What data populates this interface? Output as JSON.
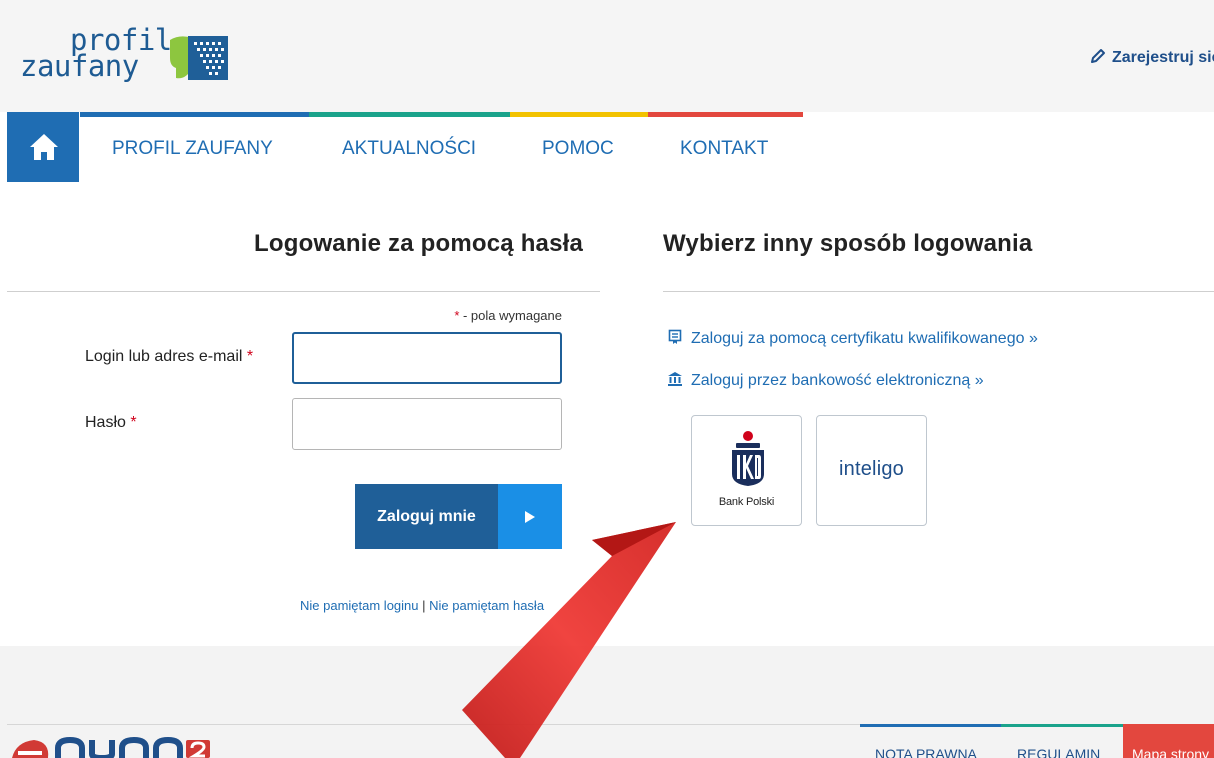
{
  "header": {
    "logo_line1": "profil",
    "logo_line2": "zaufany",
    "register_label": "Zarejestruj się"
  },
  "nav": {
    "items": [
      {
        "label": "Profil Zaufany"
      },
      {
        "label": "Aktualności"
      },
      {
        "label": "Pomoc"
      },
      {
        "label": "Kontakt"
      }
    ],
    "stripe_colors": [
      "#1f6db3",
      "#1aa38b",
      "#f2c200",
      "#e3473e"
    ]
  },
  "login": {
    "title": "Logowanie za pomocą hasła",
    "required_star": "*",
    "required_note": " - pola wymagane",
    "login_label": "Login lub adres e-mail",
    "password_label": "Hasło",
    "login_value": "",
    "password_value": "",
    "submit_label": "Zaloguj mnie",
    "forgot_login": "Nie pamiętam loginu",
    "separator": "|",
    "forgot_password": "Nie pamiętam hasła"
  },
  "alternative": {
    "title": "Wybierz inny sposób logowania",
    "certificate_link": "Zaloguj za pomocą certyfikatu kwalifikowanego »",
    "certificate_icon": "certificate-icon",
    "bank_link": "Zaloguj przez bankowość elektroniczną »",
    "bank_icon": "bank-icon",
    "banks": [
      {
        "name": "Bank Polski",
        "icon": "pko-logo-icon"
      },
      {
        "name": "inteligo"
      }
    ]
  },
  "footer": {
    "legal": "Nota prawna",
    "terms": "Regulamin",
    "sitemap": "Mapa strony"
  },
  "colors": {
    "primary": "#1f6db3",
    "dark_blue": "#1f5f98",
    "button_light": "#1a8fe6",
    "required": "#d0021b",
    "arrow_red": "#e52a28"
  }
}
